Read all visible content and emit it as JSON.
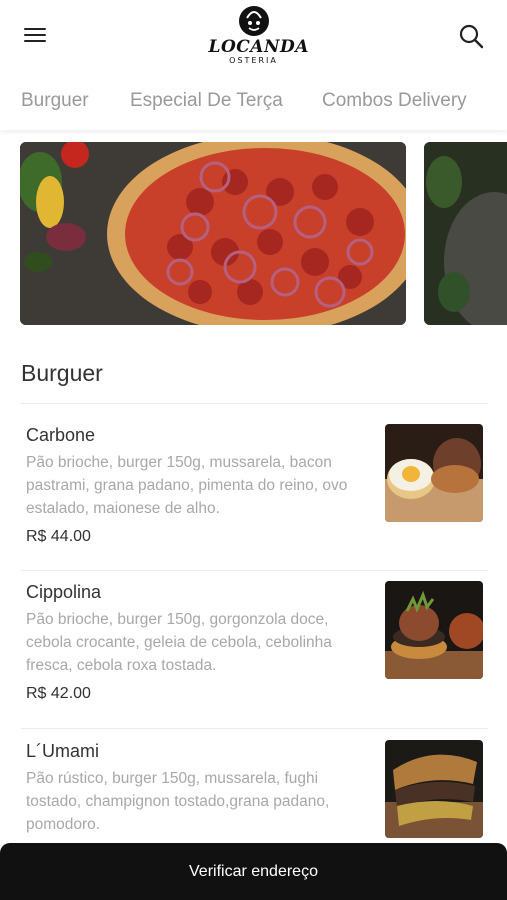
{
  "header": {
    "logo_name": "LOCANDA",
    "logo_sub": "OSTERIA",
    "logo_mark_text": "LO"
  },
  "tabs": [
    "Burguer",
    "Especial De Terça",
    "Combos Delivery"
  ],
  "section": {
    "title": "Burguer"
  },
  "items": [
    {
      "name": "Carbone",
      "description": "Pão brioche, burger 150g, mussarela, bacon pastrami, grana padano, pimenta do reino, ovo estalado, maionese de alho.",
      "price": "R$ 44.00"
    },
    {
      "name": "Cippolina",
      "description": "Pão brioche, burger 150g, gorgonzola doce, cebola crocante, geleia de cebola, cebolinha fresca, cebola roxa tostada.",
      "price": "R$ 42.00"
    },
    {
      "name": "L´Umami",
      "description": "Pão rústico, burger 150g, mussarela, fughi tostado, champignon tostado,grana padano, pomodoro.",
      "price": ""
    }
  ],
  "bottom_bar": {
    "label": "Verificar endereço"
  },
  "colors": {
    "bottom_bar_bg": "#111111",
    "tab_text": "#999999",
    "description_text": "#a8a8a8"
  }
}
